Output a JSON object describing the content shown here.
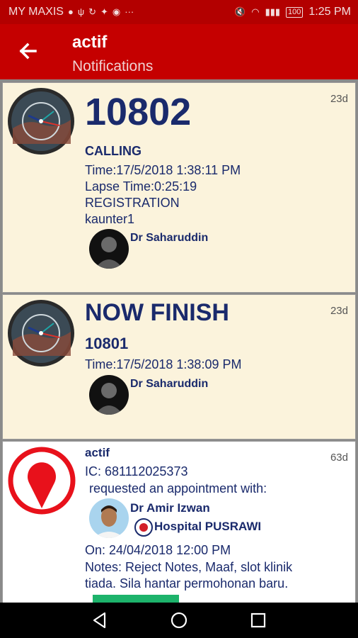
{
  "status_bar": {
    "carrier": "MY MAXIS",
    "battery": "100",
    "time": "1:25 PM"
  },
  "app_bar": {
    "title": "actif",
    "subtitle": "Notifications"
  },
  "notifications": [
    {
      "age": "23d",
      "number": "10802",
      "status": "CALLING",
      "time": "Time:17/5/2018 1:38:11 PM",
      "lapse": "Lapse Time:0:25:19",
      "department": "REGISTRATION",
      "counter": "kaunter1",
      "doctor": "Dr Saharuddin"
    },
    {
      "age": "23d",
      "status": "NOW FINISH",
      "number": "10801",
      "time": "Time:17/5/2018 1:38:09 PM",
      "doctor": "Dr Saharuddin"
    },
    {
      "age": "63d",
      "sender": "actif",
      "ic": "IC: 681112025373",
      "request_text": "requested an appointment with:",
      "doctor": "Dr Amir Izwan",
      "hospital": "Hospital PUSRAWI",
      "date": "On: 24/04/2018 12:00 PM",
      "notes_line1": "Notes: Reject Notes, Maaf, slot klinik",
      "notes_line2": "tiada. Sila hantar permohonan baru."
    }
  ],
  "colors": {
    "status_bar": "#b30000",
    "app_bar": "#c50000",
    "text_navy": "#1a2a6c",
    "card_cream": "#fbf3dc",
    "pin_red": "#e8111b",
    "accent_green": "#1db36b"
  }
}
